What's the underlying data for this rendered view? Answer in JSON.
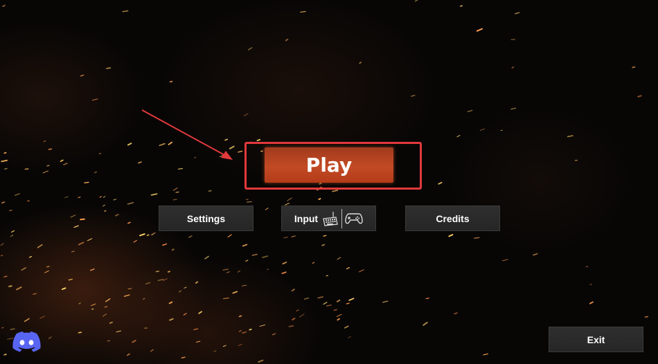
{
  "menu": {
    "play_label": "Play",
    "settings_label": "Settings",
    "input_label": "Input",
    "credits_label": "Credits",
    "exit_label": "Exit"
  },
  "icons": {
    "input": [
      "keyboard-icon",
      "gamepad-icon"
    ],
    "social": "discord-icon"
  },
  "colors": {
    "play_button": "#c24a24",
    "menu_button": "#2b2b2b",
    "annotation": "#e2393c",
    "discord": "#5865f2"
  }
}
